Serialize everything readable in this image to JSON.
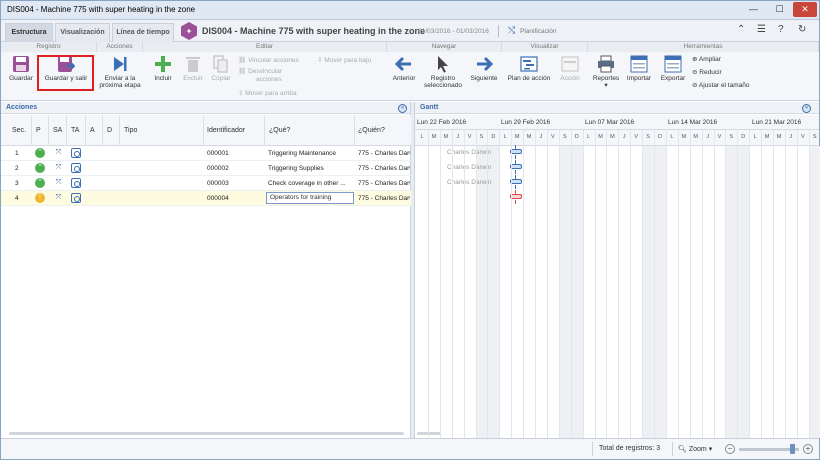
{
  "window": {
    "title": "DIS004 - Machine 775 with super heating in the zone",
    "min": "—",
    "max": "☐",
    "close": "✕"
  },
  "tabs": [
    {
      "label": "Estructura",
      "active": true
    },
    {
      "label": "Visualización",
      "active": false
    },
    {
      "label": "Línea de tiempo",
      "active": false
    }
  ],
  "doc": {
    "title": "DIS004 - Machine 775 with super heating in the zone",
    "dates": "01/03/2016 - 01/03/2016",
    "planning": "Planificación"
  },
  "ribbon": {
    "groups": [
      "Registro",
      "Acciones",
      "Editar",
      "Navegar",
      "Visualizar",
      "Herramientas"
    ],
    "save": "Guardar",
    "save_exit": "Guardar y salir",
    "send_next": [
      "Enviar a la",
      "próxima etapa"
    ],
    "include": "Incluir",
    "delete": "Excluir",
    "copy": "Copiar",
    "link_actions": "Vincular acciones",
    "unlink_actions": [
      "Desvincular",
      "acciones"
    ],
    "move_down": "Mover para bajo",
    "move_up": "Mover para arriba",
    "previous": "Anterior",
    "selected_record": [
      "Registro",
      "seleccionado"
    ],
    "next": "Siguiente",
    "action_plan": "Plan de acción",
    "action": "Acción",
    "reports": "Reportes",
    "import": "Importar",
    "export": "Exportar",
    "zoom_in": "Ampliar",
    "zoom_out": "Reducir",
    "fit_size": "Ajustar el tamaño"
  },
  "actions_panel": {
    "title": "Acciones",
    "collapse": "«",
    "columns": [
      "Sec.",
      "P",
      "SA",
      "TA",
      "A",
      "D",
      "Tipo",
      "Identificador",
      "¿Qué?",
      "¿Quién?"
    ],
    "rows": [
      {
        "seq": "1",
        "status": "green",
        "status_glyph": "⌃",
        "id": "000001",
        "what": "Triggering Maintenance",
        "who": "775 - Charles Darwin"
      },
      {
        "seq": "2",
        "status": "green",
        "status_glyph": "⌃",
        "id": "000002",
        "what": "Triggering Supplies",
        "who": "775 - Charles Darwin"
      },
      {
        "seq": "3",
        "status": "green",
        "status_glyph": "⌃",
        "id": "000003",
        "what": "Check coverage in other ...",
        "who": "775 - Charles Darwin"
      },
      {
        "seq": "4",
        "status": "yellow",
        "status_glyph": "!",
        "id": "000004",
        "what": "Operators for training",
        "who": "775 - Charles Darwin",
        "selected": true
      }
    ]
  },
  "gantt": {
    "title": "Gantt",
    "expand": "»",
    "weeks": [
      "Lun 22 Feb 2016",
      "Lun 29 Feb 2016",
      "Lun 07 Mar 2016",
      "Lun 14 Mar 2016",
      "Lun 21 Mar 2016"
    ],
    "days": [
      "L",
      "M",
      "M",
      "J",
      "V",
      "S",
      "D"
    ],
    "labels": [
      "Charles Darwin",
      "Charles Darwin",
      "Charles Darwin"
    ]
  },
  "status": {
    "total_label": "Total de registros: 3",
    "zoom_label": "Zoom",
    "zoom_level": 0.9
  },
  "colors": {
    "accent": "#3d6aa8",
    "highlight": "#e02020",
    "green": "#4caf50",
    "warning": "#f2b52f"
  }
}
